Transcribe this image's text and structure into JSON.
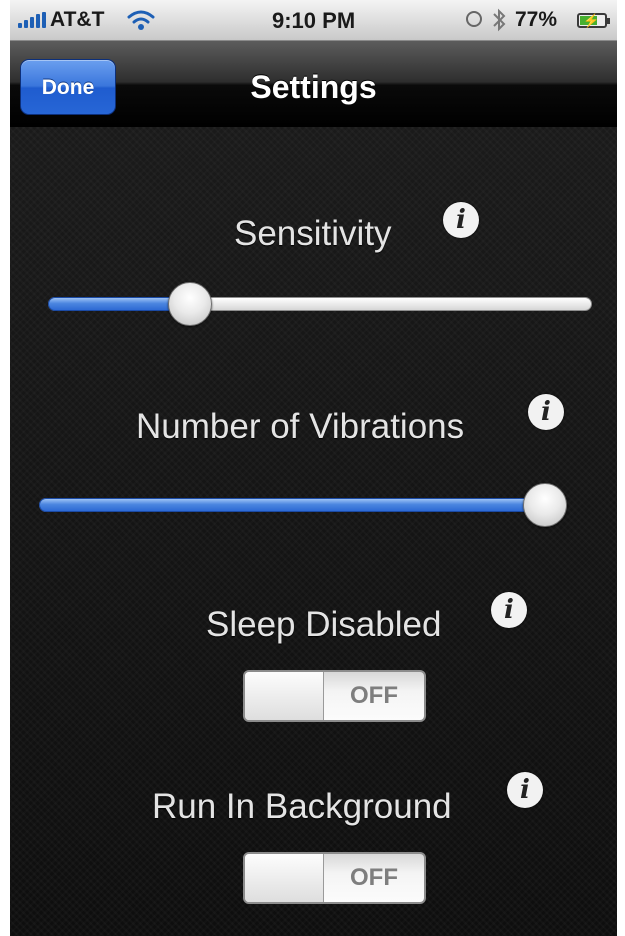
{
  "status_bar": {
    "carrier": "AT&T",
    "time": "9:10 PM",
    "battery_percent": "77%",
    "battery_level": 0.77,
    "icons": [
      "signal-icon",
      "wifi-icon",
      "orientation-lock-icon",
      "bluetooth-icon",
      "battery-icon"
    ]
  },
  "nav": {
    "done_label": "Done",
    "title": "Settings"
  },
  "settings": {
    "sensitivity": {
      "label": "Sensitivity",
      "value": 0.24
    },
    "vibrations": {
      "label": "Number of Vibrations",
      "value": 1.0
    },
    "sleep_disabled": {
      "label": "Sleep Disabled",
      "state": "OFF"
    },
    "run_in_background": {
      "label": "Run In Background",
      "state": "OFF"
    },
    "info_glyph": "i"
  },
  "colors": {
    "accent": "#2e6ad4",
    "done_button": "#3a76dc",
    "background": "#141414"
  }
}
